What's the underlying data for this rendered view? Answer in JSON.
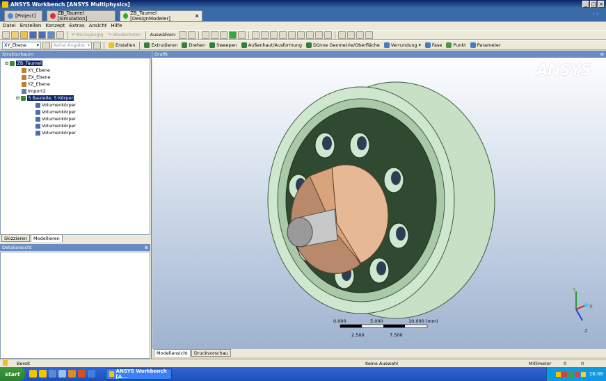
{
  "window": {
    "title": "ANSYS Workbench [ANSYS Multiphysics]"
  },
  "tabs": [
    {
      "label": "[Project]"
    },
    {
      "label": "ZB_Taumel [Simulation]"
    },
    {
      "label": "ZB_Taumel [DesignModeler]"
    }
  ],
  "tab_close": "×",
  "menu": [
    "Datei",
    "Erstellen",
    "Konzept",
    "Extras",
    "Ansicht",
    "Hilfe"
  ],
  "toolbar1": {
    "undo": "Rückgängig",
    "redo": "Wiederholen",
    "select_label": "Auswählen:"
  },
  "toolbar2": {
    "plane": "XY_Ebene",
    "sketch": "Keine Angabe",
    "generate": "Erstellen",
    "extrude": "Extrudieren",
    "revolve": "Drehen",
    "sweep": "Sweepen",
    "skin": "Außenhaut/Ausformung",
    "thin": "Dünne Geometrie/Oberfläche",
    "blend": "Verrundung",
    "chamfer": "Fase",
    "point": "Punkt",
    "parameter": "Parameter"
  },
  "tree": {
    "header": "Strukturbaum",
    "root": "ZB_Taumel",
    "items": [
      "XY_Ebene",
      "ZX_Ebene",
      "YZ_Ebene",
      "Import2"
    ],
    "parts": "5 Bauteile, 5 Körper",
    "bodies": [
      "Volumenkörper",
      "Volumenkörper",
      "Volumenkörper",
      "Volumenkörper",
      "Volumenkörper"
    ]
  },
  "left_tabs": [
    "Skizzieren",
    "Modellieren"
  ],
  "details_header": "Detailansicht",
  "graphics": {
    "header": "Grafik",
    "logo": "ANSYS",
    "scale_top": [
      "0.000",
      "5.000",
      "10.000 (mm)"
    ],
    "scale_bottom": [
      "2.500",
      "7.500"
    ],
    "triad": {
      "x": "X",
      "y": "Y",
      "z": "Z"
    }
  },
  "graphics_tabs": [
    "Modellansicht",
    "Druckvorschau"
  ],
  "status": {
    "state": "Bereit",
    "selection": "Keine Auswahl",
    "unit": "Millimeter",
    "v1": "0",
    "v2": "0"
  },
  "taskbar": {
    "start": "start",
    "task": "ANSYS Workbench [A...",
    "clock": "16:08"
  },
  "colors": {
    "title_blue": "#0a246a",
    "ring_green": "#cfe6cf",
    "disk_dark": "#2f4a30",
    "half_disk": "#e6b893",
    "shaft": "#b8b8b8",
    "logo_yellow": "#f5c400"
  }
}
